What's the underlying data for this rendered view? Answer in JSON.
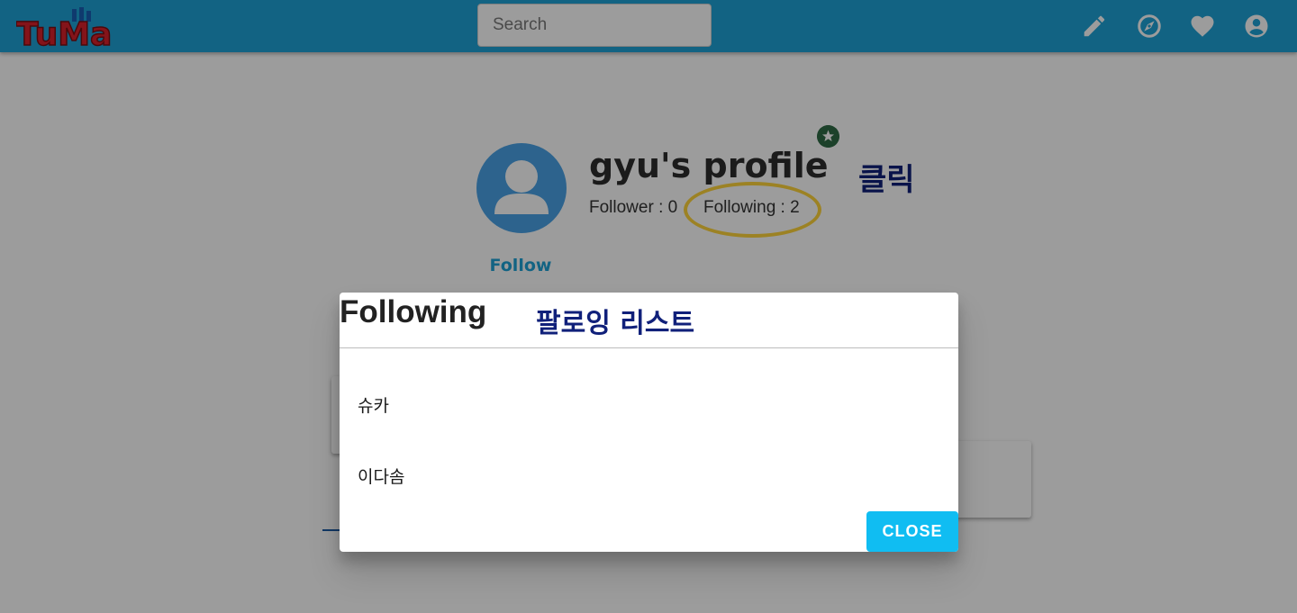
{
  "appbar": {
    "logo_text": "TuMa",
    "search": {
      "placeholder": "Search",
      "value": ""
    },
    "nav_icons": [
      "pencil-icon",
      "compass-icon",
      "heart-icon",
      "account-circle-icon"
    ]
  },
  "profile": {
    "title": "gyu's profile",
    "follower_label": "Follower : 0",
    "following_label": "Following : 2",
    "follow_button": "Follow",
    "badge_icon": "star-icon",
    "annotation_click": "클릭"
  },
  "dialog": {
    "title": "Following",
    "annotation": "팔로잉 리스트",
    "items": [
      "슈카",
      "이다솜"
    ],
    "close_label": "CLOSE"
  },
  "colors": {
    "appbar": "#1ea2d6",
    "avatar": "#4aa3e6",
    "badge": "#2f6b45",
    "highlight": "#ffd43b",
    "annotation": "#10207a",
    "close_button": "#10bdf2"
  }
}
